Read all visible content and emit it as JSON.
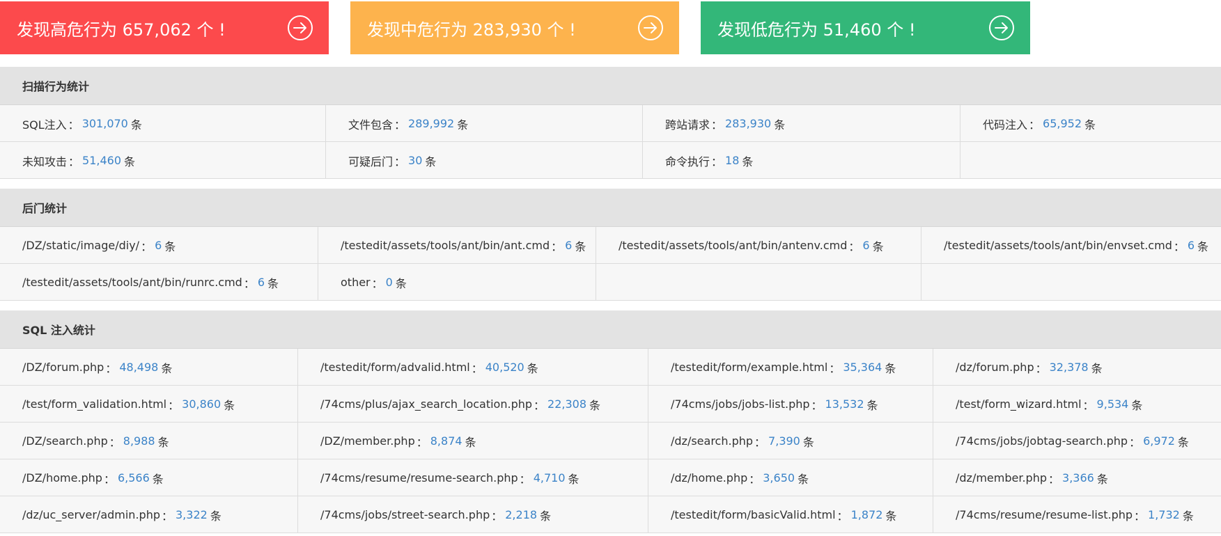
{
  "banners": [
    {
      "text": "发现高危行为 657,062 个 !",
      "color": "#fc4a4c",
      "icon": "arrow-right-circle-icon"
    },
    {
      "text": "发现中危行为 283,930 个 !",
      "color": "#fdb34d",
      "icon": "arrow-right-circle-icon"
    },
    {
      "text": "发现低危行为 51,460 个 !",
      "color": "#33b779",
      "icon": "arrow-right-circle-icon"
    }
  ],
  "sep": "：",
  "unit": "条",
  "scan": {
    "title": "扫描行为统计",
    "rows": [
      [
        {
          "label": "SQL注入",
          "value": "301,070"
        },
        {
          "label": "文件包含",
          "value": "289,992"
        },
        {
          "label": "跨站请求",
          "value": "283,930"
        },
        {
          "label": "代码注入",
          "value": "65,952"
        }
      ],
      [
        {
          "label": "未知攻击",
          "value": "51,460"
        },
        {
          "label": "可疑后门",
          "value": "30"
        },
        {
          "label": "命令执行",
          "value": "18"
        },
        null
      ]
    ]
  },
  "backdoor": {
    "title": "后门统计",
    "rows": [
      [
        {
          "label": "/DZ/static/image/diy/",
          "value": "6"
        },
        {
          "label": "/testedit/assets/tools/ant/bin/ant.cmd",
          "value": "6"
        },
        {
          "label": "/testedit/assets/tools/ant/bin/antenv.cmd",
          "value": "6"
        },
        {
          "label": "/testedit/assets/tools/ant/bin/envset.cmd",
          "value": "6"
        }
      ],
      [
        {
          "label": "/testedit/assets/tools/ant/bin/runrc.cmd",
          "value": "6"
        },
        {
          "label": "other",
          "value": "0"
        },
        null,
        null
      ]
    ]
  },
  "sql": {
    "title": "SQL 注入统计",
    "rows": [
      [
        {
          "label": "/DZ/forum.php",
          "value": "48,498"
        },
        {
          "label": "/testedit/form/advalid.html",
          "value": "40,520"
        },
        {
          "label": "/testedit/form/example.html",
          "value": "35,364"
        },
        {
          "label": "/dz/forum.php",
          "value": "32,378"
        }
      ],
      [
        {
          "label": "/test/form_validation.html",
          "value": "30,860"
        },
        {
          "label": "/74cms/plus/ajax_search_location.php",
          "value": "22,308"
        },
        {
          "label": "/74cms/jobs/jobs-list.php",
          "value": "13,532"
        },
        {
          "label": "/test/form_wizard.html",
          "value": "9,534"
        }
      ],
      [
        {
          "label": "/DZ/search.php",
          "value": "8,988"
        },
        {
          "label": "/DZ/member.php",
          "value": "8,874"
        },
        {
          "label": "/dz/search.php",
          "value": "7,390"
        },
        {
          "label": "/74cms/jobs/jobtag-search.php",
          "value": "6,972"
        }
      ],
      [
        {
          "label": "/DZ/home.php",
          "value": "6,566"
        },
        {
          "label": "/74cms/resume/resume-search.php",
          "value": "4,710"
        },
        {
          "label": "/dz/home.php",
          "value": "3,650"
        },
        {
          "label": "/dz/member.php",
          "value": "3,366"
        }
      ],
      [
        {
          "label": "/dz/uc_server/admin.php",
          "value": "3,322"
        },
        {
          "label": "/74cms/jobs/street-search.php",
          "value": "2,218"
        },
        {
          "label": "/testedit/form/basicValid.html",
          "value": "1,872"
        },
        {
          "label": "/74cms/resume/resume-list.php",
          "value": "1,732"
        }
      ]
    ]
  }
}
